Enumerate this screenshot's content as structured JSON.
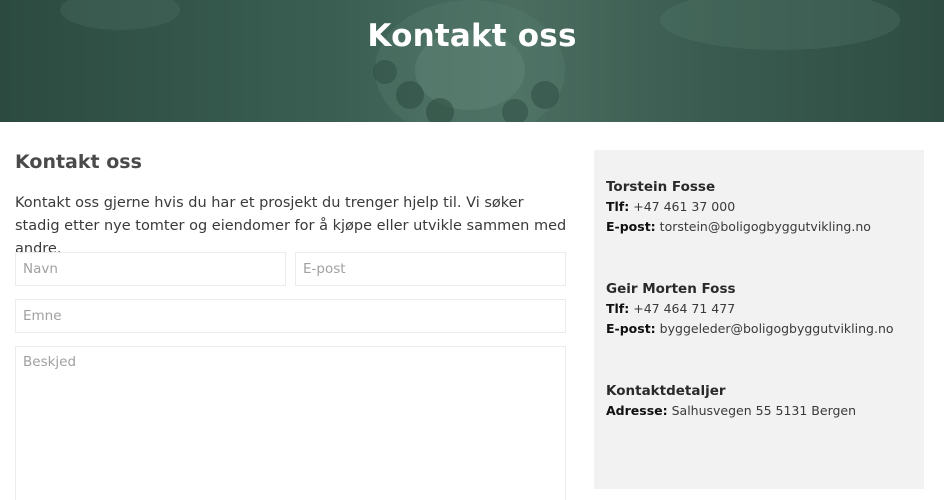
{
  "hero": {
    "title": "Kontakt oss"
  },
  "section": {
    "heading": "Kontakt oss",
    "intro": "Kontakt oss gjerne hvis du har et prosjekt du trenger hjelp til. Vi søker stadig etter nye tomter og eiendomer for å kjøpe eller utvikle sammen med andre."
  },
  "form": {
    "name_placeholder": "Navn",
    "email_placeholder": "E-post",
    "subject_placeholder": "Emne",
    "message_placeholder": "Beskjed"
  },
  "contacts": [
    {
      "name": "Torstein Fosse",
      "phone_label": "Tlf:",
      "phone": "+47 461 37 000",
      "email_label": "E-post:",
      "email": "torstein@boligogbyggutvikling.no"
    },
    {
      "name": "Geir Morten Foss",
      "phone_label": "Tlf:",
      "phone": "+47 464 71 477",
      "email_label": "E-post:",
      "email": "byggeleder@boligogbyggutvikling.no"
    }
  ],
  "details": {
    "heading": "Kontaktdetaljer",
    "address_label": "Adresse:",
    "address": "Salhusvegen 55 5131 Bergen"
  },
  "colors": {
    "hero_bg": "#3a5f52",
    "panel_bg": "#f2f2f2",
    "text": "#3a3a3a"
  }
}
